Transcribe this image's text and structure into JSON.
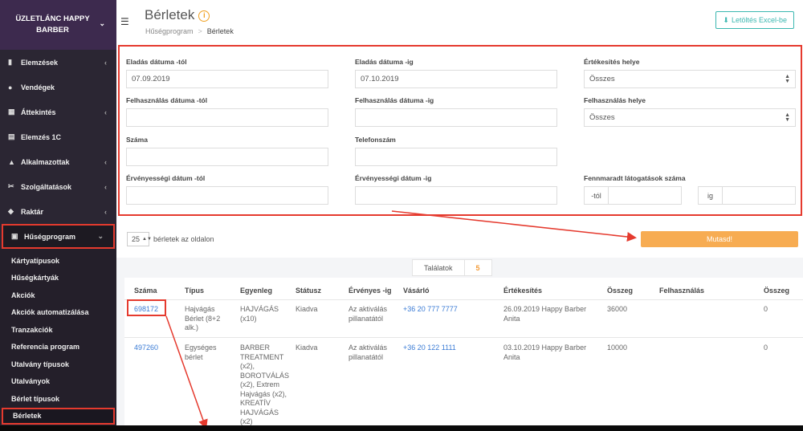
{
  "sidebar": {
    "brand": "ÜZLETLÁNC HAPPY BARBER",
    "items": [
      {
        "label": "Elemzések",
        "icon": "bar-chart-icon",
        "chevron": true
      },
      {
        "label": "Vendégek",
        "icon": "users-icon",
        "chevron": false
      },
      {
        "label": "Áttekintés",
        "icon": "grid-icon",
        "chevron": true
      },
      {
        "label": "Elemzés 1C",
        "icon": "document-icon",
        "chevron": false
      },
      {
        "label": "Alkalmazottak",
        "icon": "user-icon",
        "chevron": true
      },
      {
        "label": "Szolgáltatások",
        "icon": "scissors-icon",
        "chevron": true
      },
      {
        "label": "Raktár",
        "icon": "box-icon",
        "chevron": true
      },
      {
        "label": "Hűségprogram",
        "icon": "gift-icon",
        "chevron": true
      }
    ],
    "subitems": [
      "Kártyatípusok",
      "Hűségkártyák",
      "Akciók",
      "Akciók automatizálása",
      "Tranzakciók",
      "Referencia program",
      "Utalvány típusok",
      "Utalványok",
      "Bérlet típusok",
      "Bérletek"
    ]
  },
  "header": {
    "title": "Bérletek",
    "breadcrumb_parent": "Hűségprogram",
    "breadcrumb_sep": ">",
    "breadcrumb_current": "Bérletek",
    "excel_label": "Letöltés Excel-be"
  },
  "filters": {
    "sale_from_label": "Eladás dátuma -tól",
    "sale_from_value": "07.09.2019",
    "sale_to_label": "Eladás dátuma -ig",
    "sale_to_value": "07.10.2019",
    "sale_place_label": "Értékesítés helye",
    "sale_place_value": "Összes",
    "use_from_label": "Felhasználás dátuma -tól",
    "use_to_label": "Felhasználás dátuma -ig",
    "use_place_label": "Felhasználás helye",
    "use_place_value": "Összes",
    "number_label": "Száma",
    "phone_label": "Telefonszám",
    "valid_from_label": "Érvényességi dátum -tól",
    "valid_to_label": "Érvényességi dátum -ig",
    "visits_label": "Fennmaradt látogatások száma",
    "visits_from_addon": "-tól",
    "visits_to_addon": "ig"
  },
  "list": {
    "per_page": "25",
    "per_page_label": "bérletek az oldalon",
    "show_button": "Mutasd!",
    "results_label": "Találatok",
    "results_count": "5"
  },
  "table": {
    "columns": [
      "Száma",
      "Típus",
      "Egyenleg",
      "Státusz",
      "Érvényes -ig",
      "Vásárló",
      "Értékesítés",
      "Összeg",
      "Felhasználás",
      "Összeg"
    ],
    "rows": [
      {
        "number": "698172",
        "type": "Hajvágás Bérlet (8+2 alk.)",
        "balance": "HAJVÁGÁS (x10)",
        "status": "Kiadva",
        "valid": "Az aktiválás pillanatától",
        "buyer": "+36 20 777 7777",
        "sale": "26.09.2019 Happy Barber Anita",
        "amount": "36000",
        "usage": "",
        "amount2": "0"
      },
      {
        "number": "497260",
        "type": "Egységes bérlet",
        "balance": "BARBER TREATMENT (x2), BOROTVÁLÁS (x2), Extrem Hajvágás (x2), KREATÍV HAJVÁGÁS (x2)",
        "status": "Kiadva",
        "valid": "Az aktiválás pillanatától",
        "buyer": "+36 20 122 1111",
        "sale": "03.10.2019 Happy Barber Anita",
        "amount": "10000",
        "usage": "",
        "amount2": "0"
      }
    ]
  },
  "colors": {
    "sidebar": "#2b2633",
    "accent_orange": "#f7ac52",
    "highlight_red": "#e53a2e",
    "link_blue": "#3a7bd5",
    "teal": "#3bb7b0"
  }
}
